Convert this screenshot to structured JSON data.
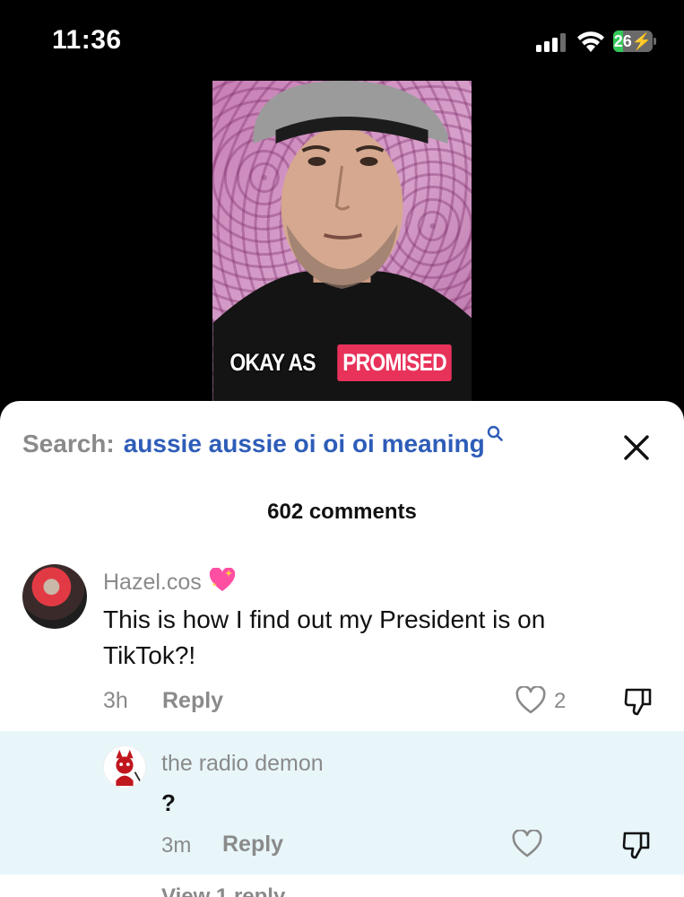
{
  "status_bar": {
    "time": "11:36",
    "battery_level": "26",
    "battery_fraction": 0.26
  },
  "video": {
    "caption_plain": "OKAY AS",
    "caption_highlight": "PROMISED",
    "highlight_color": "#e8325a"
  },
  "comments_sheet": {
    "search_prefix": "Search:",
    "search_query": "aussie aussie oi oi oi meaning",
    "comment_count": "602 comments",
    "comments": [
      {
        "username": "Hazel.cos",
        "badge_icon": "sparkling-heart-icon",
        "text": "This is how I find out my President is on TikTok?!",
        "time": "3h",
        "reply_label": "Reply",
        "likes": "2"
      },
      {
        "username": "the radio demon",
        "text": "?",
        "time": "3m",
        "reply_label": "Reply"
      }
    ],
    "view_replies_label": "View 1 reply"
  },
  "colors": {
    "accent_blue": "#2e5db8",
    "reply_highlight_bg": "#e8f6fa",
    "muted_text": "#8a8a8a"
  }
}
